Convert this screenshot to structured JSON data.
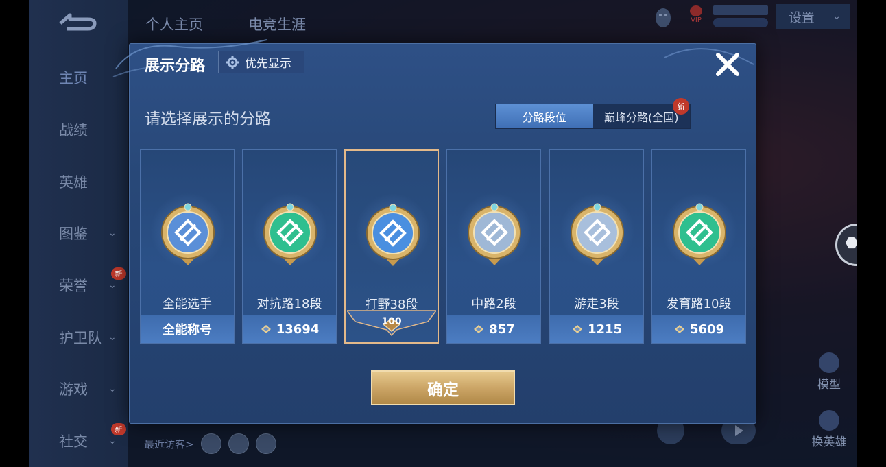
{
  "sidebar": {
    "items": [
      {
        "label": "主页",
        "chevron": false,
        "new": false
      },
      {
        "label": "战绩",
        "chevron": false,
        "new": false
      },
      {
        "label": "英雄",
        "chevron": false,
        "new": false
      },
      {
        "label": "图鉴",
        "chevron": true,
        "new": false
      },
      {
        "label": "荣誉",
        "chevron": true,
        "new": true
      },
      {
        "label": "护卫队",
        "chevron": true,
        "new": false
      },
      {
        "label": "游戏",
        "chevron": true,
        "new": false
      },
      {
        "label": "社交",
        "chevron": true,
        "new": true
      }
    ],
    "new_badge_text": "新",
    "chevron_glyph": "⌄"
  },
  "top_tabs": [
    "个人主页",
    "电竞生涯"
  ],
  "settings_label": "设置",
  "vip_label": "VIP",
  "visitors_label": "最近访客>",
  "right_buttons": {
    "model": "模型",
    "switch_hero": "换英雄"
  },
  "modal": {
    "title": "展示分路",
    "priority_label": "优先显示",
    "subtitle": "请选择展示的分路",
    "tabs": [
      {
        "label": "分路段位",
        "active": true
      },
      {
        "label": "巅峰分路(全国)",
        "active": false
      }
    ],
    "tab_new_badge": "新",
    "cards": [
      {
        "name": "全能选手",
        "value": "全能称号",
        "show_points_icon": false,
        "selected": false,
        "emblem_color": "#5a8fd8",
        "emblem_icon": "allround-emblem-icon"
      },
      {
        "name": "对抗路18段",
        "value": "13694",
        "show_points_icon": true,
        "selected": false,
        "emblem_color": "#2fbf8f",
        "emblem_icon": "clash-lane-emblem-icon"
      },
      {
        "name": "打野38段",
        "value": "100",
        "show_points_icon": false,
        "selected": true,
        "emblem_color": "#4a8fe0",
        "emblem_icon": "jungle-emblem-icon"
      },
      {
        "name": "中路2段",
        "value": "857",
        "show_points_icon": true,
        "selected": false,
        "emblem_color": "#9fb8d6",
        "emblem_icon": "mid-lane-emblem-icon"
      },
      {
        "name": "游走3段",
        "value": "1215",
        "show_points_icon": true,
        "selected": false,
        "emblem_color": "#a8bfdc",
        "emblem_icon": "roam-emblem-icon"
      },
      {
        "name": "发育路10段",
        "value": "5609",
        "show_points_icon": true,
        "selected": false,
        "emblem_color": "#2fbf8f",
        "emblem_icon": "farm-lane-emblem-icon"
      }
    ],
    "confirm_label": "确定"
  },
  "colors": {
    "accent_gold": "#e3b98a",
    "tab_active": "#4f80c5",
    "modal_bg": "#284878",
    "new_red": "#c0392b"
  }
}
